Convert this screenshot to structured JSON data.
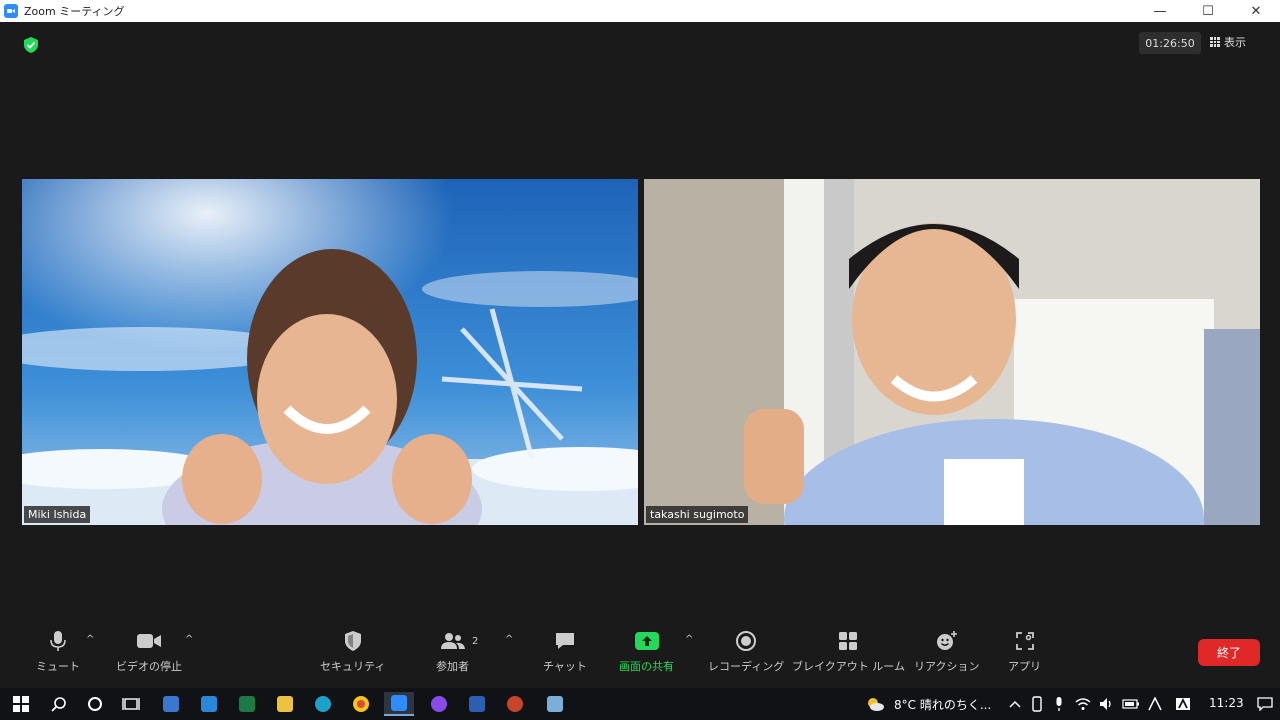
{
  "window": {
    "title": "Zoom ミーティング",
    "timer": "01:26:50",
    "view_label": "表示",
    "controls": {
      "minimize": "—",
      "maximize": "☐",
      "close": "✕"
    }
  },
  "participants": [
    {
      "name": "Miki Ishida"
    },
    {
      "name": "takashi sugimoto"
    }
  ],
  "toolbar": {
    "mute": "ミュート",
    "video": "ビデオの停止",
    "security": "セキュリティ",
    "participants": "参加者",
    "participant_count": "2",
    "chat": "チャット",
    "share": "画面の共有",
    "record": "レコーディング",
    "breakout": "ブレイクアウト ルーム",
    "reactions": "リアクション",
    "apps": "アプリ",
    "end": "終了"
  },
  "taskbar": {
    "weather": "8°C  晴れのちく...",
    "time": "11:23"
  },
  "colors": {
    "accent_green": "#23d959",
    "end_red": "#e02828",
    "zoom_blue": "#2d8cff"
  }
}
